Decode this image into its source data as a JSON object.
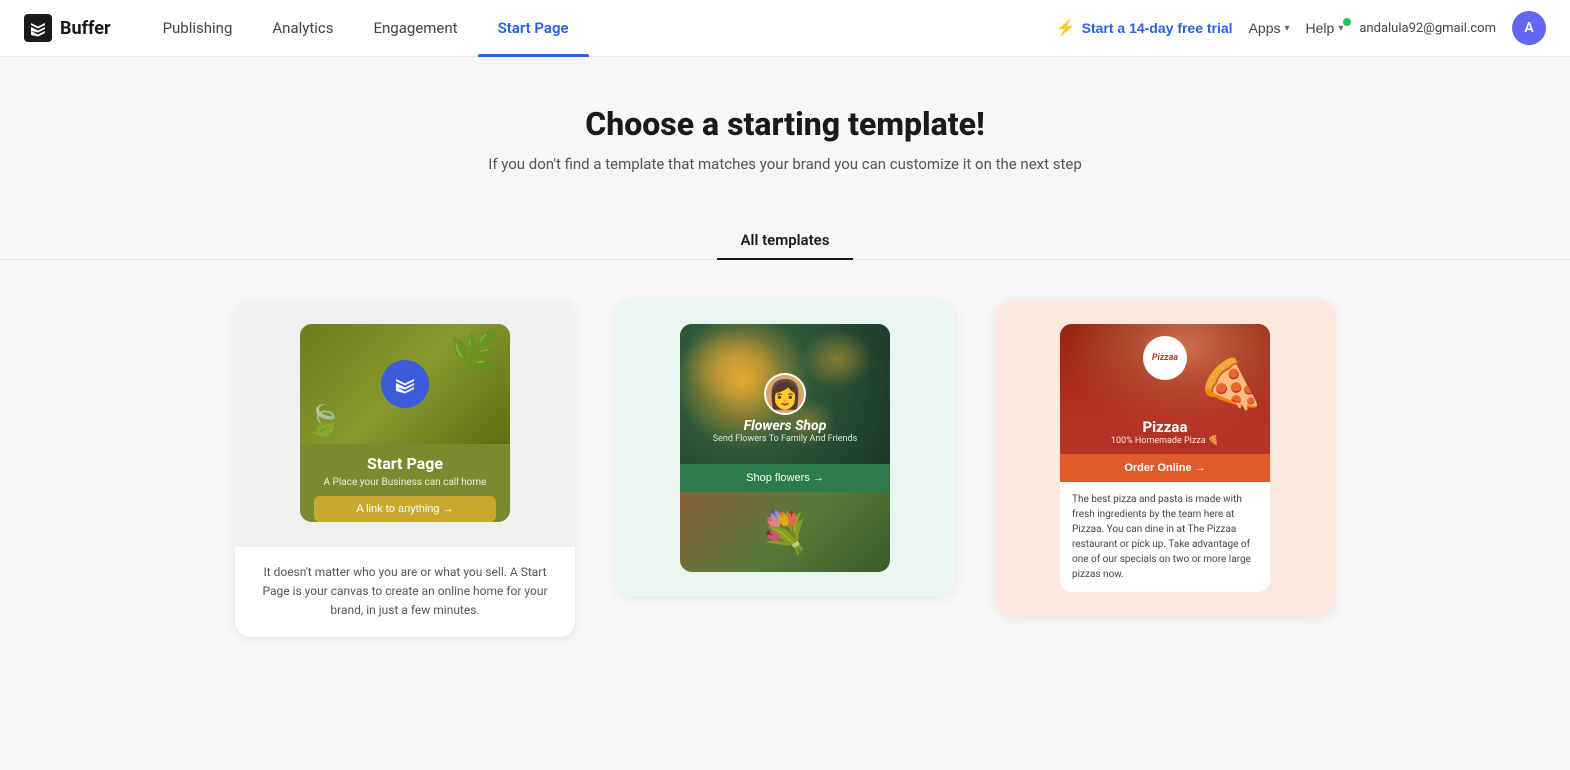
{
  "app": {
    "logo_text": "Buffer",
    "logo_icon": "≡"
  },
  "nav": {
    "links": [
      {
        "id": "publishing",
        "label": "Publishing",
        "active": false
      },
      {
        "id": "analytics",
        "label": "Analytics",
        "active": false
      },
      {
        "id": "engagement",
        "label": "Engagement",
        "active": false
      },
      {
        "id": "start-page",
        "label": "Start Page",
        "active": true
      }
    ],
    "trial_label": "Start a 14-day free trial",
    "apps_label": "Apps",
    "help_label": "Help",
    "user_email": "andalula92@gmail.com"
  },
  "hero": {
    "title": "Choose a starting template!",
    "subtitle": "If you don't find a template that matches your brand you can customize it on the next step"
  },
  "tabs": [
    {
      "id": "all-templates",
      "label": "All templates",
      "active": true
    }
  ],
  "templates": [
    {
      "id": "start-page",
      "title": "Start Page",
      "subtitle": "A Place your Business can call home",
      "link_label": "A link to anything →",
      "description": "It doesn't matter who you are or what you sell. A Start Page is your canvas to create an online home for your brand, in just a few minutes."
    },
    {
      "id": "flowers-shop",
      "title": "Flowers Shop",
      "subtitle": "Send Flowers To Family And Friends",
      "cta_label": "Shop flowers →"
    },
    {
      "id": "pizzaa",
      "title": "Pizzaa",
      "subtitle": "100% Homemade Pizza 🍕",
      "logo_text": "Pizzaa",
      "cta_label": "Order Online →",
      "description": "The best pizza and pasta is made with fresh ingredients by the team here at Pizzaa. You can dine in at The Pizzaa restaurant or pick up. Take advantage of one of our specials on two or more large pizzas now."
    }
  ],
  "icons": {
    "bolt": "⚡",
    "chevron_down": "▾",
    "arrow_right": "→"
  }
}
